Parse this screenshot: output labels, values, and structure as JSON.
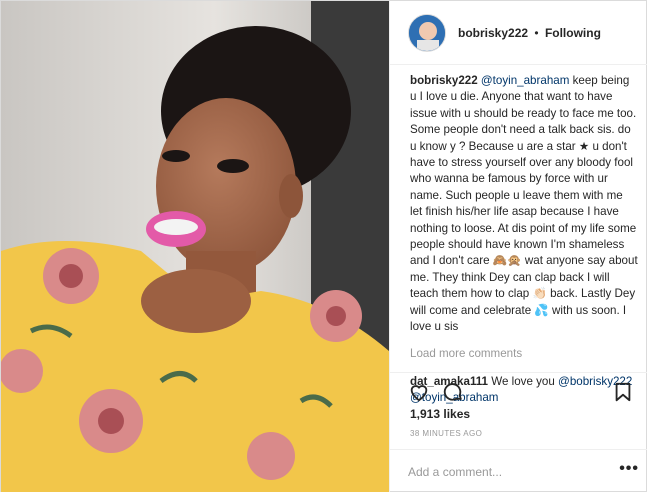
{
  "post": {
    "username": "bobrisky222",
    "separator": "•",
    "follow_status": "Following",
    "caption": {
      "username": "bobrisky222",
      "mention": "@toyin_abraham",
      "text": " keep being u I love u die. Anyone that want to have issue with u should be ready to face me too. Some people don't need a talk back sis. do u know y ? Because u are a star ★ u don't have to stress yourself over any bloody fool who wanna be famous by force with ur name. Such people u leave them with me let finish his/her life asap because I have nothing to loose. At dis point of my life some people should have known I'm shameless and I don't care 🙈🙊 wat anyone say about me. They think Dey can clap back I will teach them how to clap 👏🏻 back. Lastly Dey will come and celebrate 💦 with us soon. I love u sis"
    },
    "load_more": "Load more comments",
    "comments": [
      {
        "username": "dat_amaka111",
        "text": " We love you ",
        "mentions": [
          "@bobrisky222",
          "@toyin_abraham"
        ]
      }
    ],
    "likes": "1,913 likes",
    "time_ago": "38 MINUTES AGO",
    "add_comment_placeholder": "Add a comment...",
    "more_options": "•••"
  },
  "icons": {
    "like": "heart-icon",
    "comment": "comment-bubble-icon",
    "save": "bookmark-icon"
  }
}
